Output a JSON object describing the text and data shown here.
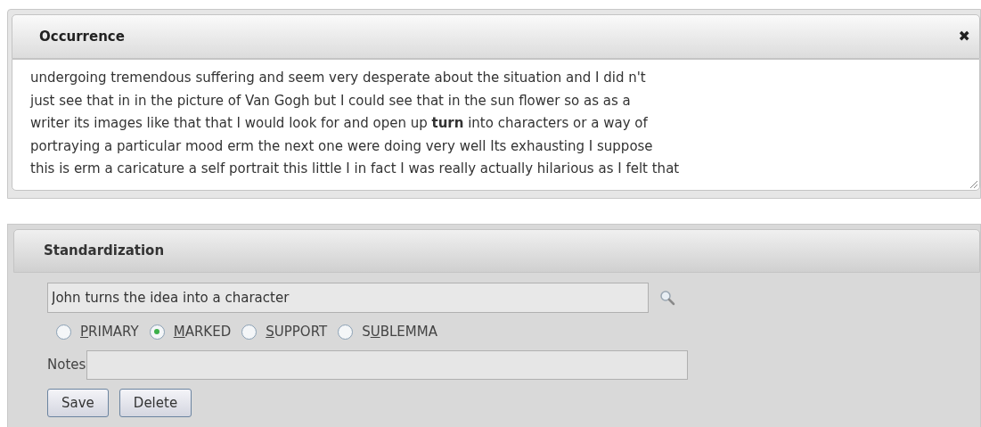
{
  "occurrence": {
    "title": "Occurrence",
    "close": "✖",
    "lines": [
      "undergoing tremendous suffering and seem very desperate about the situation and I did n't",
      "just see that in in the picture of Van Gogh but I could see that in the sun flower so as as a",
      "writer its images like that that I would look for and open up **turn** into characters or a way of",
      "portraying a particular mood erm the next one were doing very well Its exhausting I suppose",
      "this is erm a caricature a self portrait this little I in fact I was really actually hilarious as I felt that"
    ]
  },
  "standardization": {
    "title": "Standardization",
    "value": "John turns the idea into a character",
    "options": [
      {
        "key": "P",
        "after": "RIMARY",
        "selected": false
      },
      {
        "key": "M",
        "after": "ARKED",
        "selected": true
      },
      {
        "key": "S",
        "after": "UPPORT",
        "selected": false
      },
      {
        "before": "S",
        "key": "U",
        "after": "BLEMMA",
        "selected": false
      }
    ],
    "notes_label": "Notes",
    "buttons": [
      "Save",
      "Delete"
    ]
  }
}
